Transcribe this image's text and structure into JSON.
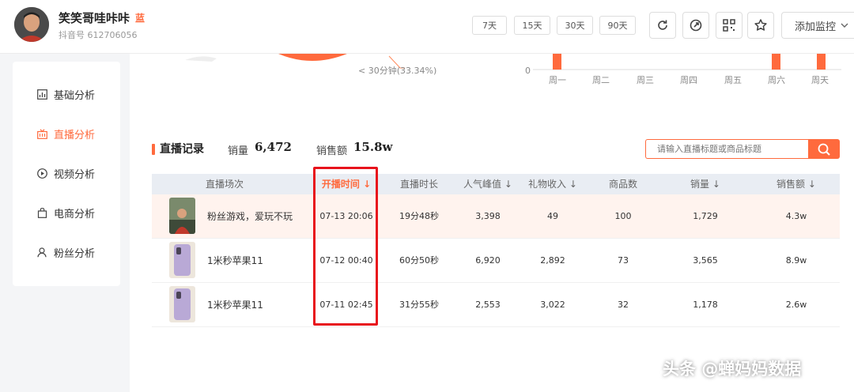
{
  "account": {
    "name": "笑笑哥哇咔咔",
    "badge": "蓝",
    "id_text": "抖音号 612706056"
  },
  "header": {
    "ranges": [
      "7天",
      "15天",
      "30天",
      "90天"
    ],
    "icons": [
      "refresh-icon",
      "share-icon",
      "qrcode-icon",
      "star-icon"
    ],
    "monitor_label": "添加监控"
  },
  "sidebar": {
    "items": [
      {
        "label": "基础分析",
        "icon": "bar-chart-icon",
        "active": false
      },
      {
        "label": "直播分析",
        "icon": "live-icon",
        "active": true
      },
      {
        "label": "视频分析",
        "icon": "play-icon",
        "active": false
      },
      {
        "label": "电商分析",
        "icon": "shopping-bag-icon",
        "active": false
      },
      {
        "label": "粉丝分析",
        "icon": "fans-icon",
        "active": false
      }
    ]
  },
  "top_charts": {
    "pie_legend": "< 30分钟(33.34%)",
    "bar_zero": "0",
    "weekdays": [
      "周一",
      "周二",
      "周三",
      "周四",
      "周五",
      "周六",
      "周天"
    ]
  },
  "live_records": {
    "title": "直播记录",
    "sales_label": "销量",
    "sales_value": "6,472",
    "revenue_label": "销售额",
    "revenue_value": "15.8w",
    "search_placeholder": "请输入直播标题或商品标题",
    "columns": [
      "直播场次",
      "开播时间",
      "直播时长",
      "人气峰值",
      "礼物收入",
      "商品数",
      "销量",
      "销售额"
    ],
    "rows": [
      {
        "title": "粉丝游戏，爱玩不玩",
        "start": "07-13 20:06",
        "duration": "19分48秒",
        "peak": "3,398",
        "gift": "49",
        "goods": "100",
        "sales": "1,729",
        "revenue": "4.3w"
      },
      {
        "title": "1米秒苹果11",
        "start": "07-12 00:40",
        "duration": "60分50秒",
        "peak": "6,920",
        "gift": "2,892",
        "goods": "73",
        "sales": "3,565",
        "revenue": "8.9w"
      },
      {
        "title": "1米秒苹果11",
        "start": "07-11 02:45",
        "duration": "31分55秒",
        "peak": "2,553",
        "gift": "3,022",
        "goods": "32",
        "sales": "1,178",
        "revenue": "2.6w"
      }
    ]
  },
  "watermark": "头条 @蝉妈妈数据",
  "colors": {
    "accent": "#ff6a3d",
    "highlight_box": "#e8131c",
    "table_header_bg": "#e9edf3"
  }
}
